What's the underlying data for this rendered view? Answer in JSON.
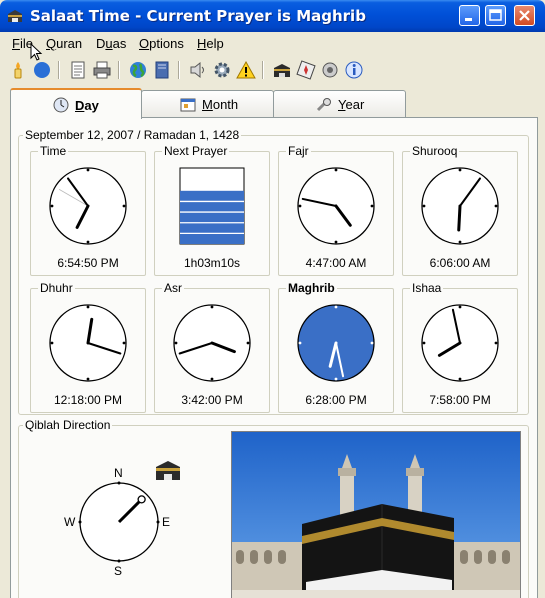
{
  "window": {
    "title": "Salaat Time - Current Prayer is Maghrib"
  },
  "menu": {
    "items": [
      {
        "pre": "",
        "key": "F",
        "post": "ile"
      },
      {
        "pre": "",
        "key": "Q",
        "post": "uran"
      },
      {
        "pre": "D",
        "key": "u",
        "post": "as"
      },
      {
        "pre": "",
        "key": "O",
        "post": "ptions"
      },
      {
        "pre": "",
        "key": "H",
        "post": "elp"
      }
    ]
  },
  "toolbar": {
    "icons": [
      "candle-icon",
      "moon-globe-icon",
      "calendar-page-icon",
      "printer-icon",
      "globe-icon",
      "book-icon",
      "speaker-icon",
      "settings-gear-icon",
      "warning-icon",
      "kaaba-icon",
      "compass-card-icon",
      "location-pin-icon",
      "info-icon"
    ]
  },
  "tabs": [
    {
      "pre": "",
      "key": "D",
      "post": "ay"
    },
    {
      "pre": "",
      "key": "M",
      "post": "onth"
    },
    {
      "pre": "",
      "key": "Y",
      "post": "ear"
    }
  ],
  "date_header": "September 12, 2007 / Ramadan 1, 1428",
  "clocks": [
    {
      "label": "Time",
      "value": "6:54:50 PM",
      "hour": 6,
      "minute": 54,
      "second": 50,
      "bold": false,
      "highlight": false
    },
    {
      "label": "Next Prayer",
      "value": "1h03m10s",
      "countdown_fraction": 0.7,
      "bold": false,
      "highlight": false
    },
    {
      "label": "Fajr",
      "value": "4:47:00 AM",
      "hour": 4,
      "minute": 47,
      "bold": false,
      "highlight": false
    },
    {
      "label": "Shurooq",
      "value": "6:06:00 AM",
      "hour": 6,
      "minute": 6,
      "bold": false,
      "highlight": false
    },
    {
      "label": "Dhuhr",
      "value": "12:18:00 PM",
      "hour": 12,
      "minute": 18,
      "bold": false,
      "highlight": false
    },
    {
      "label": "Asr",
      "value": "3:42:00 PM",
      "hour": 3,
      "minute": 42,
      "bold": false,
      "highlight": false
    },
    {
      "label": "Maghrib",
      "value": "6:28:00 PM",
      "hour": 6,
      "minute": 28,
      "bold": true,
      "highlight": true
    },
    {
      "label": "Ishaa",
      "value": "7:58:00 PM",
      "hour": 7,
      "minute": 58,
      "bold": false,
      "highlight": false
    }
  ],
  "qiblah": {
    "label": "Qiblah Direction",
    "north": "N",
    "south": "S",
    "east": "E",
    "west": "W",
    "bearing_degrees": 45
  },
  "colors": {
    "highlight": "#3a6fc6",
    "titlebar": "#0050d8",
    "tab_accent": "#e68b2c"
  }
}
